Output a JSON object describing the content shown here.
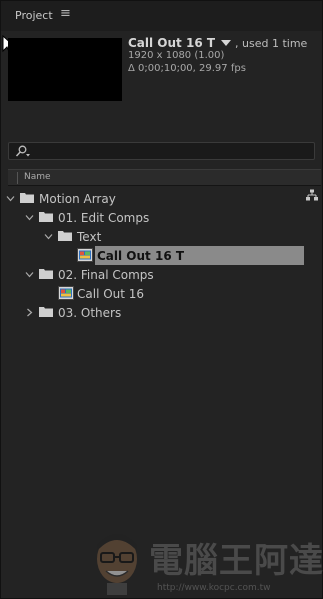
{
  "panel": {
    "tab_label": "Project",
    "menu_glyph": "≡"
  },
  "preview": {
    "title": "Call Out 16 T",
    "used": ", used 1 time",
    "dimensions": "1920 x 1080 (1.00)",
    "duration": "Δ 0;00;10;00, 29.97 fps"
  },
  "search": {
    "value": "",
    "placeholder": ""
  },
  "columns": {
    "name": "Name"
  },
  "tree": {
    "motion_array": "Motion Array",
    "edit_comps": "01. Edit Comps",
    "text": "Text",
    "call_out_16_t": "Call Out 16 T",
    "final_comps": "02. Final Comps",
    "call_out_16": "Call Out 16",
    "others": "03. Others"
  },
  "watermark": {
    "text": "電腦王阿達",
    "url": "http://www.kocpc.com.tw"
  },
  "colors": {
    "panel_bg": "#232323",
    "header_bg": "#1d1d1d",
    "selection": "#8a8a8a",
    "folder": "#cfcfcf"
  }
}
